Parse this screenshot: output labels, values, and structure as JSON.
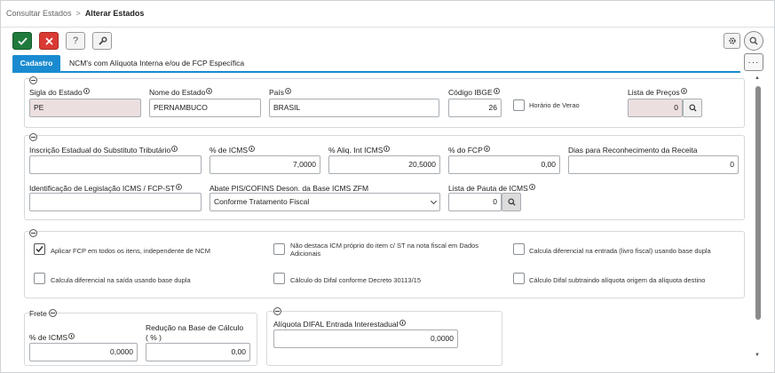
{
  "breadcrumb": {
    "parent": "Consultar Estados",
    "separator": ">",
    "current": "Alterar Estados"
  },
  "toolbar": {
    "help_label": "?"
  },
  "tabs": [
    {
      "label": "Cadastro",
      "active": true
    },
    {
      "label": "NCM's com Alíquota Interna e/ou de FCP Específica",
      "active": false
    }
  ],
  "more_label": "···",
  "estado": {
    "sigla": {
      "label": "Sigla do Estado",
      "value": "PE"
    },
    "nome": {
      "label": "Nome do Estado",
      "value": "PERNAMBUCO"
    },
    "pais": {
      "label": "País",
      "value": "BRASIL"
    },
    "codigo_ibge": {
      "label": "Código IBGE",
      "value": "26"
    },
    "horario_verao": {
      "label": "Horário de Verao",
      "checked": false
    },
    "lista_precos": {
      "label": "Lista de Preços",
      "value": "0"
    }
  },
  "icms": {
    "inscricao_st": {
      "label": "Inscrição Estadual do Substituto Tributário",
      "value": ""
    },
    "perc_icms": {
      "label": "% de ICMS",
      "value": "7,0000"
    },
    "aliq_int_icms": {
      "label": "% Aliq. Int ICMS",
      "value": "20,5000"
    },
    "perc_fcp": {
      "label": "% do FCP",
      "value": "0,00"
    },
    "dias_receita": {
      "label": "Dias para Reconhecimento da Receita",
      "value": "0"
    },
    "ident_legislacao": {
      "label": "Identificação de Legislação ICMS / FCP-ST",
      "value": ""
    },
    "abate_pis": {
      "label": "Abate PIS/COFINS Deson. da Base ICMS ZFM",
      "value": "Conforme Tratamento Fiscal"
    },
    "lista_pauta": {
      "label": "Lista de Pauta de ICMS",
      "value": "0"
    }
  },
  "options": [
    {
      "label": "Aplicar FCP em todos os itens, independente de NCM",
      "checked": true
    },
    {
      "label": "Não destaca ICM próprio do item c/ ST na nota fiscal em Dados Adicionais",
      "checked": false
    },
    {
      "label": "Calcula diferencial na entrada (livro fiscal) usando base dupla",
      "checked": false
    },
    {
      "label": "Calcula diferencial na saída usando base dupla",
      "checked": false
    },
    {
      "label": "Cálculo do Difal conforme Decreto 30113/15",
      "checked": false
    },
    {
      "label": "Cálculo Difal subtraindo alíquota origem da alíquota destino",
      "checked": false
    }
  ],
  "frete": {
    "title": "Frete",
    "perc_icms": {
      "label": "% de ICMS",
      "value": "0,0000"
    },
    "reducao_base": {
      "label": "Redução na Base de Cálculo",
      "label2": "( % )",
      "value": "0,00"
    }
  },
  "difal": {
    "aliquota_entrada": {
      "label": "Alíquota DIFAL Entrada Interestadual",
      "value": "0,0000"
    }
  },
  "colors": {
    "accent": "#1a8bd1",
    "save": "#1f7a3c",
    "cancel": "#d93b34",
    "readonly": "#ecdfe0"
  }
}
